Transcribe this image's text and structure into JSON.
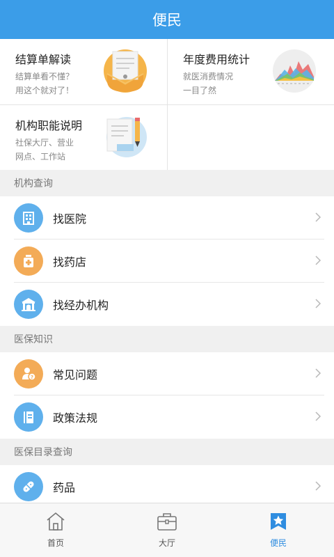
{
  "header": {
    "title": "便民"
  },
  "cards": [
    {
      "title": "结算单解读",
      "desc": [
        "结算单看不懂？",
        "用这个就对了！"
      ],
      "icon": "document-envelope-icon"
    },
    {
      "title": "年度费用统计",
      "desc": [
        "就医消费情况",
        "一目了然"
      ],
      "icon": "area-chart-icon"
    },
    {
      "title": "机构职能说明",
      "desc": [
        "社保大厅、营业",
        "网点、工作站"
      ],
      "icon": "notepad-pencil-icon"
    }
  ],
  "sections": [
    {
      "title": "机构查询",
      "items": [
        {
          "label": "找医院",
          "icon": "hospital-icon"
        },
        {
          "label": "找药店",
          "icon": "pharmacy-icon"
        },
        {
          "label": "找经办机构",
          "icon": "agency-building-icon"
        }
      ]
    },
    {
      "title": "医保知识",
      "items": [
        {
          "label": "常见问题",
          "icon": "faq-person-icon"
        },
        {
          "label": "政策法规",
          "icon": "policy-book-icon"
        }
      ]
    },
    {
      "title": "医保目录查询",
      "items": [
        {
          "label": "药品",
          "icon": "pill-icon"
        }
      ]
    }
  ],
  "tabbar": {
    "tabs": [
      {
        "label": "首页",
        "icon": "home-icon"
      },
      {
        "label": "大厅",
        "icon": "briefcase-icon"
      },
      {
        "label": "便民",
        "icon": "star-badge-icon",
        "active": true
      }
    ]
  },
  "colors": {
    "primary": "#3b9de8",
    "icon_blue": "#5fb0ec",
    "icon_orange": "#f3ab57",
    "active_tab": "#2f8de0"
  }
}
